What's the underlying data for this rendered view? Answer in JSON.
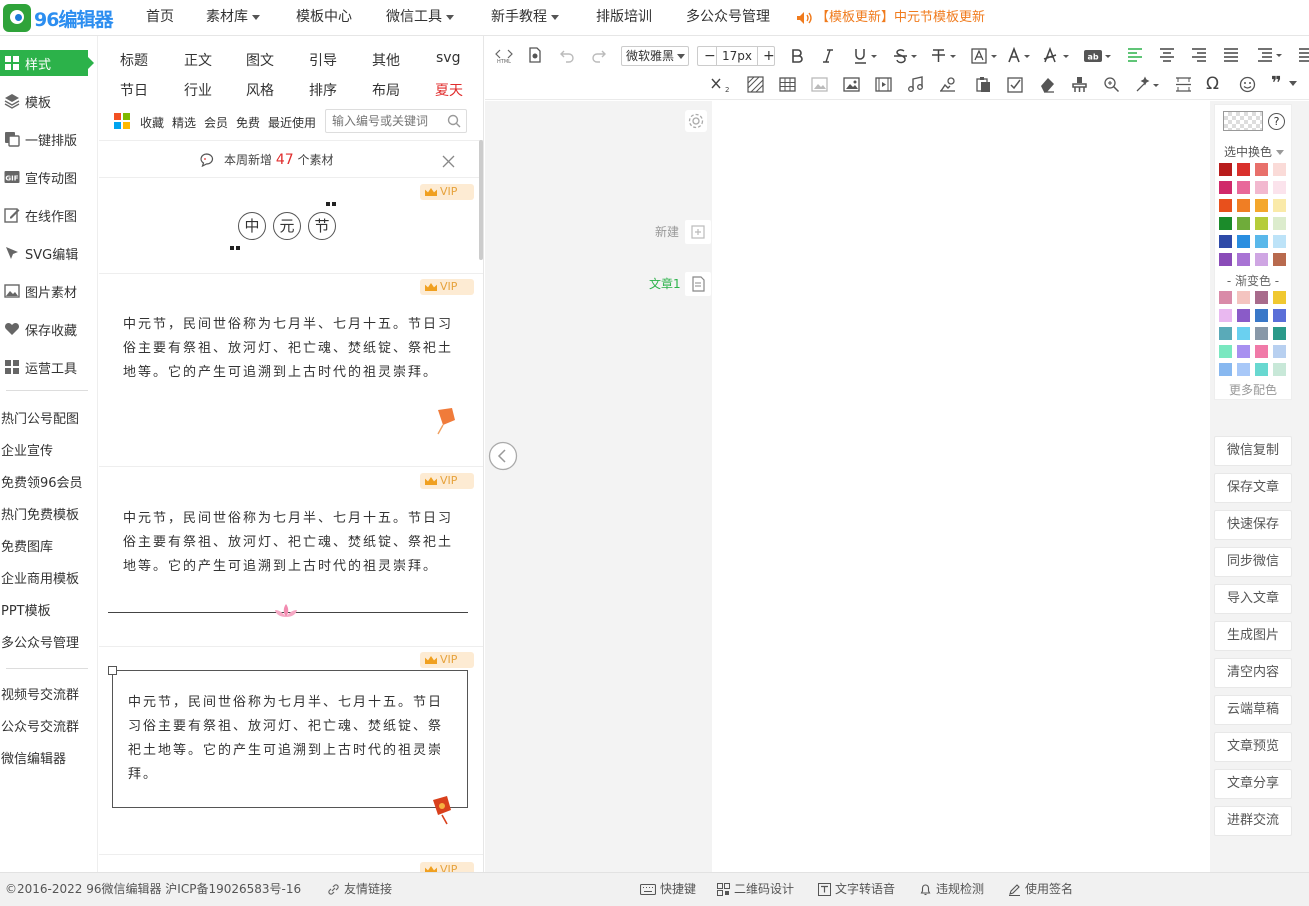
{
  "brand": {
    "name": "96编辑器"
  },
  "nav": {
    "items": [
      {
        "label": "首页",
        "dropdown": false
      },
      {
        "label": "素材库",
        "dropdown": true
      },
      {
        "label": "模板中心",
        "dropdown": false
      },
      {
        "label": "微信工具",
        "dropdown": true
      },
      {
        "label": "新手教程",
        "dropdown": true
      },
      {
        "label": "排版培训",
        "dropdown": false
      },
      {
        "label": "多公众号管理",
        "dropdown": false
      }
    ],
    "announcement": "【模板更新】中元节模板更新"
  },
  "leftmenu": {
    "items": [
      {
        "label": "样式",
        "icon": "grid-icon",
        "active": true
      },
      {
        "label": "模板",
        "icon": "layers-icon"
      },
      {
        "label": "一键排版",
        "icon": "copy-icon"
      },
      {
        "label": "宣传动图",
        "icon": "gif-icon"
      },
      {
        "label": "在线作图",
        "icon": "edit-icon"
      },
      {
        "label": "SVG编辑",
        "icon": "cursor-icon"
      },
      {
        "label": "图片素材",
        "icon": "image-icon"
      },
      {
        "label": "保存收藏",
        "icon": "heart-icon"
      },
      {
        "label": "运营工具",
        "icon": "grid-icon"
      }
    ],
    "links": [
      "热门公号配图",
      "企业宣传",
      "免费领96会员",
      "热门免费模板",
      "免费图库",
      "企业商用模板",
      "PPT模板",
      "多公众号管理"
    ],
    "links2": [
      "视频号交流群",
      "公众号交流群",
      "微信编辑器"
    ]
  },
  "panel": {
    "tabs_row1": [
      "标题",
      "正文",
      "图文",
      "引导",
      "其他",
      "svg"
    ],
    "tabs_row2": [
      "节日",
      "行业",
      "风格",
      "排序",
      "布局",
      "夏天"
    ],
    "filters": [
      "收藏",
      "精选",
      "会员",
      "免费",
      "最近使用"
    ],
    "search_placeholder": "输入编号或关键词",
    "notice_prefix": "本周新增",
    "notice_count": "47",
    "notice_suffix": "个素材",
    "vip_label": "VIP",
    "title_chars": [
      "中",
      "元",
      "节"
    ],
    "paragraph": "中元节，民间世俗称为七月半、七月十五。节日习俗主要有祭祖、放河灯、祀亡魂、焚纸锭、祭祀土地等。它的产生可追溯到上古时代的祖灵崇拜。"
  },
  "toolbar": {
    "font_family": "微软雅黑",
    "font_size": "17px",
    "minus": "−",
    "plus": "+",
    "omega": "Ω",
    "quote": "❞"
  },
  "editor": {
    "new_label": "新建",
    "article_label": "文章1"
  },
  "colorpanel": {
    "select_label": "选中换色",
    "gradient_label": "- 渐变色 -",
    "more_label": "更多配色",
    "help": "?",
    "solid_colors": [
      "#b81c1c",
      "#d9302c",
      "#e8706b",
      "#fadbd8",
      "#d0296a",
      "#e8689a",
      "#f2b8cf",
      "#fbe3ec",
      "#e8501c",
      "#f07e24",
      "#f4a72c",
      "#faeaa9",
      "#1b8b2a",
      "#6fac3a",
      "#b5cc3a",
      "#dceccd",
      "#2e4aa8",
      "#2a8ee0",
      "#5ab8ea",
      "#bde3f8",
      "#8a4cb8",
      "#a873d4",
      "#cfa6e3",
      "#b86a4e"
    ],
    "gradient_colors": [
      "#d98aa8",
      "#f4c4c0",
      "#a86b8c",
      "#f0c830",
      "#e9b8f0",
      "#8a5bc8",
      "#3a78c8",
      "#5a6fd8",
      "#5aaab8",
      "#6ad0f0",
      "#8898a8",
      "#2a9a8a",
      "#7ae8c0",
      "#a890f0",
      "#f07aa8",
      "#b8d0f0",
      "#88b8f0",
      "#a8c8f8",
      "#68d8d0",
      "#c8e8d8"
    ]
  },
  "right_buttons": [
    "微信复制",
    "保存文章",
    "快速保存",
    "同步微信",
    "导入文章",
    "生成图片",
    "清空内容",
    "云端草稿",
    "文章预览",
    "文章分享",
    "进群交流"
  ],
  "footer": {
    "copyright": "©2016-2022 96微信编辑器 沪ICP备19026583号-16",
    "friend_link": "友情链接",
    "tools": [
      "快捷键",
      "二维码设计",
      "文字转语音",
      "违规检测",
      "使用签名"
    ]
  },
  "colors": {
    "accent": "#2cb24a",
    "blue": "#2c8ef0",
    "orange": "#f07b1d",
    "red": "#e02d2d"
  }
}
